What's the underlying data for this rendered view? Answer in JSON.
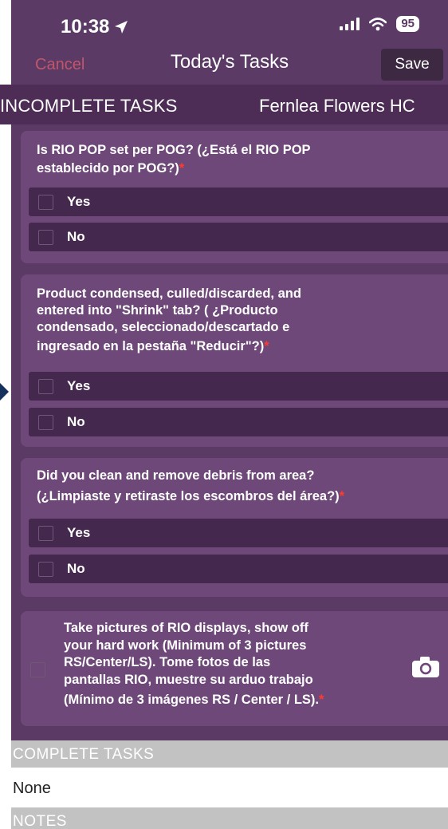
{
  "status_bar": {
    "time": "10:38",
    "battery": "95"
  },
  "nav": {
    "cancel_label": "Cancel",
    "title": "Today's Tasks",
    "save_label": "Save"
  },
  "incomplete_header": {
    "label": "INCOMPLETE TASKS",
    "store": "Fernlea Flowers HC"
  },
  "tasks": [
    {
      "question_lines": [
        "Is RIO POP set per POG?   (¿Está el RIO POP",
        "establecido por POG?)"
      ],
      "required_mark": "*",
      "options": [
        "Yes",
        "No"
      ]
    },
    {
      "question_lines": [
        "Product condensed, culled/discarded, and",
        "entered into \"Shrink\" tab?     ( ¿Producto",
        "condensado, seleccionado/descartado e",
        "ingresado en la pestaña \"Reducir\"?)"
      ],
      "required_mark": "*",
      "options": [
        "Yes",
        "No"
      ]
    },
    {
      "question_lines": [
        "Did you clean and remove debris from area?",
        "(¿Limpiaste y retiraste los escombros del área?)"
      ],
      "required_mark": "*",
      "options": [
        "Yes",
        "No"
      ]
    }
  ],
  "photo_task": {
    "lines": [
      "Take pictures of RIO displays, show off",
      "your hard work (Minimum of 3 pictures",
      "RS/Center/LS).    Tome fotos de las",
      "pantallas RIO, muestre su arduo trabajo",
      "(Mínimo de 3 imágenes RS / Center / LS)."
    ],
    "required_mark": "*",
    "icon": "camera-icon"
  },
  "complete_header": {
    "label": "COMPLETE TASKS"
  },
  "complete_value": "None",
  "notes_header": {
    "label": "NOTES"
  },
  "colors": {
    "primary_purple": "#5b3a66",
    "card_purple": "#6e4878",
    "option_purple": "#44284d",
    "required_red": "#ff3b30",
    "cancel_red": "#c2566a"
  }
}
